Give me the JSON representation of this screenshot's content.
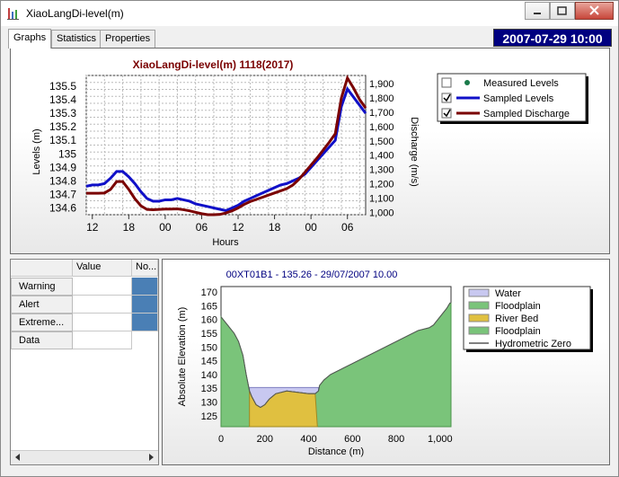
{
  "window": {
    "title": "XiaoLangDi-level(m)"
  },
  "tabs": [
    {
      "label": "Graphs"
    },
    {
      "label": "Statistics"
    },
    {
      "label": "Properties"
    }
  ],
  "datetime": "2007-07-29 10:00",
  "colors": {
    "levels": "#1010c8",
    "discharge": "#7a0000",
    "water": "#c8c8f0",
    "floodplain": "#7ac47a",
    "riverbed": "#e0c040",
    "accent": "#000080"
  },
  "top_chart": {
    "title": "XiaoLangDi-level(m)  1118(2017)",
    "ylabel_left": "Levels (m)",
    "ylabel_right": "Discharge (m/s)",
    "xlabel": "Hours",
    "legend": [
      {
        "label": "Measured Levels",
        "checked": false
      },
      {
        "label": "Sampled Levels",
        "checked": true
      },
      {
        "label": "Sampled Discharge",
        "checked": true
      }
    ]
  },
  "grid": {
    "headers": [
      "Value",
      "No..."
    ],
    "rows": [
      {
        "label": "Warning"
      },
      {
        "label": "Alert"
      },
      {
        "label": "Extreme..."
      },
      {
        "label": "Data"
      }
    ]
  },
  "bottom_chart": {
    "title": "00XT01B1 - 135.26 - 29/07/2007 10.00",
    "ylabel": "Absolute Elevation (m)",
    "xlabel": "Distance (m)",
    "legend": [
      {
        "label": "Water"
      },
      {
        "label": "Floodplain"
      },
      {
        "label": "River Bed"
      },
      {
        "label": "Floodplain"
      },
      {
        "label": "Hydrometric Zero"
      }
    ]
  },
  "chart_data": [
    {
      "type": "line",
      "title": "XiaoLangDi-level(m)  1118(2017)",
      "xlabel": "Hours",
      "ylabel": "Levels (m)",
      "y2label": "Discharge (m/s)",
      "x_ticks": [
        "12",
        "18",
        "00",
        "06",
        "12",
        "18",
        "00",
        "06"
      ],
      "x_hours": [
        0,
        1,
        2,
        3,
        4,
        5,
        6,
        7,
        8,
        9,
        10,
        11,
        12,
        13,
        14,
        15,
        16,
        17,
        18,
        19,
        20,
        21,
        22,
        23,
        24,
        25,
        26,
        27,
        28,
        29,
        30,
        31,
        32,
        33,
        34,
        35,
        36,
        37,
        38,
        39,
        40,
        41,
        42,
        43,
        44,
        45,
        46
      ],
      "ylim": [
        134.55,
        135.58
      ],
      "y_ticks": [
        134.6,
        134.7,
        134.8,
        134.9,
        135,
        135.1,
        135.2,
        135.3,
        135.4,
        135.5
      ],
      "y2lim": [
        983,
        1958
      ],
      "y2_ticks": [
        "1,000",
        "1,100",
        "1,200",
        "1,300",
        "1,400",
        "1,500",
        "1,600",
        "1,700",
        "1,800",
        "1,900"
      ],
      "series": [
        {
          "name": "Sampled Levels",
          "axis": "left",
          "values": [
            134.76,
            134.77,
            134.77,
            134.78,
            134.82,
            134.87,
            134.87,
            134.83,
            134.78,
            134.72,
            134.67,
            134.65,
            134.65,
            134.66,
            134.66,
            134.67,
            134.66,
            134.65,
            134.63,
            134.62,
            134.61,
            134.6,
            134.59,
            134.58,
            134.6,
            134.62,
            134.65,
            134.67,
            134.69,
            134.71,
            134.73,
            134.75,
            134.77,
            134.78,
            134.8,
            134.82,
            134.85,
            134.9,
            134.95,
            135.0,
            135.05,
            135.1,
            135.35,
            135.48,
            135.42,
            135.36,
            135.3
          ]
        },
        {
          "name": "Sampled Discharge",
          "axis": "right",
          "values": [
            1133,
            1133,
            1133,
            1135,
            1160,
            1215,
            1215,
            1160,
            1095,
            1045,
            1020,
            1018,
            1020,
            1022,
            1022,
            1024,
            1018,
            1010,
            1000,
            990,
            983,
            983,
            985,
            995,
            1010,
            1030,
            1055,
            1075,
            1090,
            1105,
            1120,
            1135,
            1150,
            1165,
            1190,
            1230,
            1280,
            1330,
            1380,
            1435,
            1490,
            1550,
            1800,
            1940,
            1870,
            1790,
            1730
          ]
        }
      ]
    },
    {
      "type": "area",
      "title": "00XT01B1 - 135.26 - 29/07/2007 10.00",
      "xlabel": "Distance (m)",
      "ylabel": "Absolute Elevation (m)",
      "xlim": [
        0,
        1050
      ],
      "ylim": [
        121,
        172
      ],
      "x_ticks": [
        "0",
        "200",
        "400",
        "600",
        "800",
        "1,000"
      ],
      "y_ticks": [
        125,
        130,
        135,
        140,
        145,
        150,
        155,
        160,
        165,
        170
      ],
      "water_level": 135.26,
      "profile": {
        "distance": [
          0,
          20,
          40,
          60,
          80,
          100,
          115,
          130,
          140,
          160,
          180,
          200,
          220,
          250,
          300,
          350,
          400,
          430,
          445,
          450,
          470,
          500,
          550,
          600,
          650,
          700,
          750,
          800,
          850,
          900,
          950,
          970,
          990,
          1010,
          1030,
          1045,
          1050
        ],
        "elevation": [
          161,
          159,
          157,
          155,
          152,
          147,
          140,
          134,
          132,
          129,
          128,
          129,
          131,
          133,
          134,
          133.5,
          133,
          133,
          134,
          136,
          138,
          140,
          142,
          144,
          146,
          148,
          150,
          152,
          154,
          156,
          157,
          158,
          160,
          162,
          164,
          166,
          166
        ]
      },
      "riverbed_range": [
        130,
        440
      ]
    }
  ]
}
